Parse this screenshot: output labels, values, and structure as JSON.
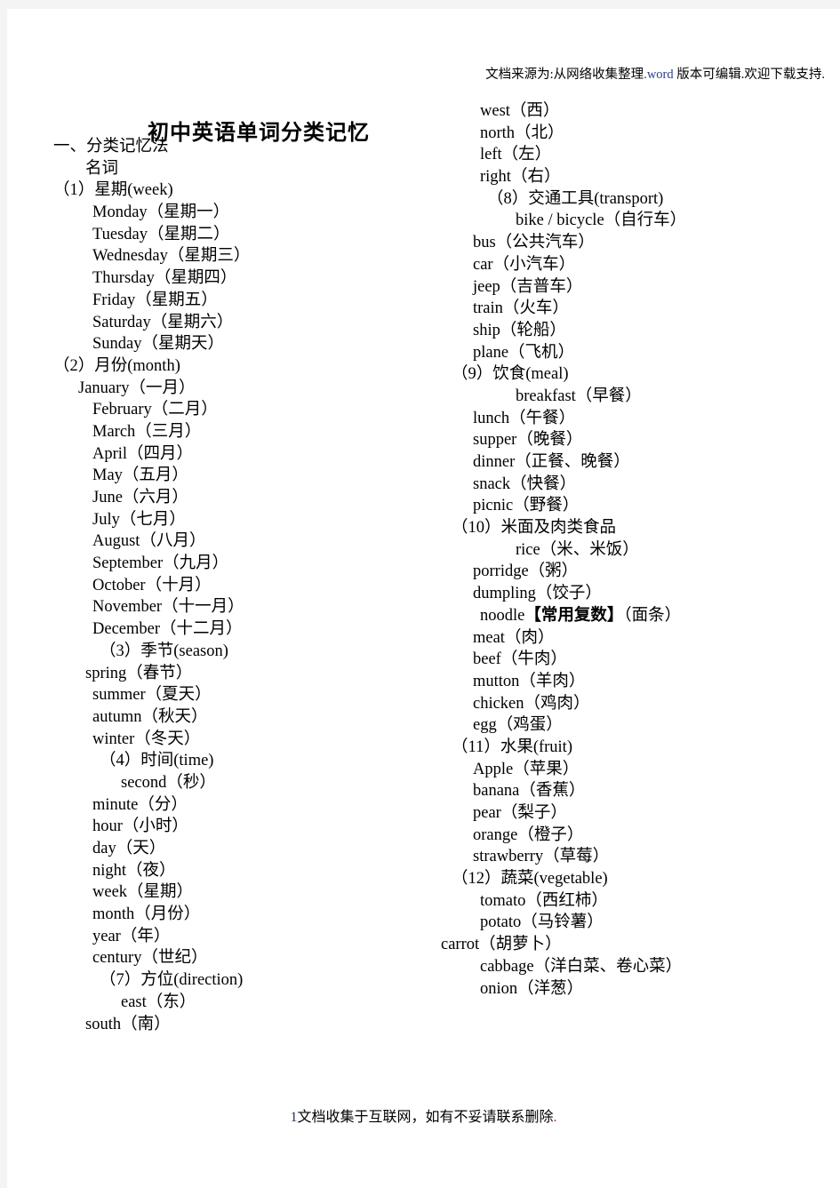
{
  "header": {
    "prefix": "文档来源为:从网络收集整理",
    "word": ".word",
    "suffix": " 版本可编辑.欢迎下载支持."
  },
  "title": "初中英语单词分类记忆",
  "footer": {
    "page_number": "1",
    "text": "文档收集于互联网，如有不妥请联系删除",
    "dot": "."
  },
  "left_column": [
    {
      "text": "一、分类记忆法",
      "indent": "i0"
    },
    {
      "text": "名词",
      "indent": "i4"
    },
    {
      "text": "（1）星期(week)",
      "indent": "i0"
    },
    {
      "text": "Monday（星期一）",
      "indent": "i5"
    },
    {
      "text": "Tuesday（星期二）",
      "indent": "i5"
    },
    {
      "text": "Wednesday（星期三）",
      "indent": "i5"
    },
    {
      "text": "Thursday（星期四）",
      "indent": "i5"
    },
    {
      "text": "Friday（星期五）",
      "indent": "i5"
    },
    {
      "text": "Saturday（星期六）",
      "indent": "i5"
    },
    {
      "text": "Sunday（星期天）",
      "indent": "i5"
    },
    {
      "text": "（2）月份(month)",
      "indent": "i0"
    },
    {
      "text": "January（一月）",
      "indent": "i3"
    },
    {
      "text": "February（二月）",
      "indent": "i5"
    },
    {
      "text": "March（三月）",
      "indent": "i5"
    },
    {
      "text": "April（四月）",
      "indent": "i5"
    },
    {
      "text": "May（五月）",
      "indent": "i5"
    },
    {
      "text": "June（六月）",
      "indent": "i5"
    },
    {
      "text": "July（七月）",
      "indent": "i5"
    },
    {
      "text": "August（八月）",
      "indent": "i5"
    },
    {
      "text": "September（九月）",
      "indent": "i5"
    },
    {
      "text": "October（十月）",
      "indent": "i5"
    },
    {
      "text": "November（十一月）",
      "indent": "i5"
    },
    {
      "text": "December（十二月）",
      "indent": "i5"
    },
    {
      "text": "（3）季节(season)",
      "indent": "i6"
    },
    {
      "text": "spring（春节）",
      "indent": "i4"
    },
    {
      "text": "summer（夏天）",
      "indent": "i5"
    },
    {
      "text": "autumn（秋天）",
      "indent": "i5"
    },
    {
      "text": "winter（冬天）",
      "indent": "i5"
    },
    {
      "text": "（4）时间(time)",
      "indent": "i6"
    },
    {
      "text": "second（秒）",
      "indent": "i9"
    },
    {
      "text": "minute（分）",
      "indent": "i5"
    },
    {
      "text": "hour（小时）",
      "indent": "i5"
    },
    {
      "text": "day（天）",
      "indent": "i5"
    },
    {
      "text": "night（夜）",
      "indent": "i5"
    },
    {
      "text": "week（星期）",
      "indent": "i5"
    },
    {
      "text": "month（月份）",
      "indent": "i5"
    },
    {
      "text": "year（年）",
      "indent": "i5"
    },
    {
      "text": "century（世纪）",
      "indent": "i5"
    },
    {
      "text": "（7）方位(direction)",
      "indent": "i6"
    },
    {
      "text": "east（东）",
      "indent": "i9"
    },
    {
      "text": "south（南）",
      "indent": "i4"
    }
  ],
  "right_column": [
    {
      "text": "west（西）",
      "indent": "i5"
    },
    {
      "text": "north（北）",
      "indent": "i5"
    },
    {
      "text": "left（左）",
      "indent": "i5"
    },
    {
      "text": "right（右）",
      "indent": "i5"
    },
    {
      "text": "（8）交通工具(transport)",
      "indent": "i6"
    },
    {
      "text": "bike / bicycle（自行车）",
      "indent": "i10"
    },
    {
      "text": "bus（公共汽车）",
      "indent": "i4"
    },
    {
      "text": "car（小汽车）",
      "indent": "i4"
    },
    {
      "text": "jeep（吉普车）",
      "indent": "i4"
    },
    {
      "text": "train（火车）",
      "indent": "i4"
    },
    {
      "text": "ship（轮船）",
      "indent": "i4"
    },
    {
      "text": "plane（飞机）",
      "indent": "i4"
    },
    {
      "text": "（9）饮食(meal)",
      "indent": "i1"
    },
    {
      "text": "breakfast（早餐）",
      "indent": "i10"
    },
    {
      "text": "lunch（午餐）",
      "indent": "i4"
    },
    {
      "text": "supper（晚餐）",
      "indent": "i4"
    },
    {
      "text": "dinner（正餐、晚餐）",
      "indent": "i4"
    },
    {
      "text": "snack（快餐）",
      "indent": "i4"
    },
    {
      "text": "picnic（野餐）",
      "indent": "i4"
    },
    {
      "text": "（10）米面及肉类食品",
      "indent": "i1"
    },
    {
      "text": "rice（米、米饭）",
      "indent": "i10"
    },
    {
      "text": "porridge（粥）",
      "indent": "i4"
    },
    {
      "text": "dumpling（饺子）",
      "indent": "i4"
    },
    {
      "text": "noodle【常用复数】（面条）",
      "indent": "i5",
      "bold_segment": "【常用复数】"
    },
    {
      "text": "meat（肉）",
      "indent": "i4"
    },
    {
      "text": "beef（牛肉）",
      "indent": "i4"
    },
    {
      "text": "mutton（羊肉）",
      "indent": "i4"
    },
    {
      "text": "chicken（鸡肉）",
      "indent": "i4"
    },
    {
      "text": "egg（鸡蛋）",
      "indent": "i4"
    },
    {
      "text": "（11）水果(fruit)",
      "indent": "i1"
    },
    {
      "text": "Apple（苹果）",
      "indent": "i4"
    },
    {
      "text": "banana（香蕉）",
      "indent": "i4"
    },
    {
      "text": "pear（梨子）",
      "indent": "i4"
    },
    {
      "text": "orange（橙子）",
      "indent": "i4"
    },
    {
      "text": "strawberry（草莓）",
      "indent": "i4"
    },
    {
      "text": "（12）蔬菜(vegetable)",
      "indent": "i1"
    },
    {
      "text": "tomato（西红柿）",
      "indent": "i5"
    },
    {
      "text": "potato（马铃薯）",
      "indent": "i5"
    },
    {
      "text": "carrot（胡萝卜）",
      "indent": "i0"
    },
    {
      "text": "cabbage（洋白菜、卷心菜）",
      "indent": "i5"
    },
    {
      "text": "onion（洋葱）",
      "indent": "i5"
    }
  ]
}
